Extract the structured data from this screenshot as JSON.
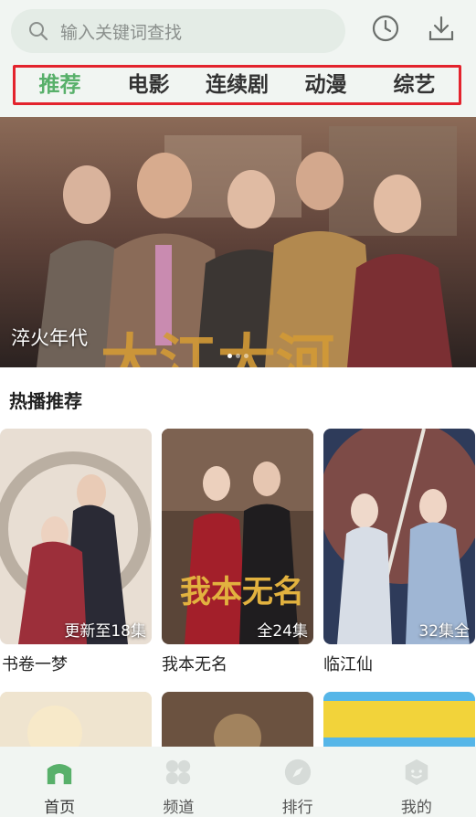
{
  "search": {
    "placeholder": "输入关键词查找"
  },
  "icons": {
    "search": "search-icon",
    "history": "clock-icon",
    "download": "download-icon"
  },
  "tabs": [
    {
      "label": "推荐",
      "active": true
    },
    {
      "label": "电影"
    },
    {
      "label": "连续剧"
    },
    {
      "label": "动漫"
    },
    {
      "label": "综艺"
    }
  ],
  "banner": {
    "title": "淬火年代"
  },
  "hot": {
    "title": "热播推荐",
    "items": [
      {
        "title": "书卷一梦",
        "badge": "更新至18集"
      },
      {
        "title": "我本无名",
        "badge": "全24集"
      },
      {
        "title": "临江仙",
        "badge": "32集全"
      }
    ]
  },
  "nav": [
    {
      "label": "首页",
      "icon": "home-icon",
      "active": true
    },
    {
      "label": "频道",
      "icon": "grid-icon"
    },
    {
      "label": "排行",
      "icon": "compass-icon"
    },
    {
      "label": "我的",
      "icon": "profile-icon"
    }
  ],
  "colors": {
    "accent": "#58b06a",
    "highlight_border": "#e3232d",
    "header_bg": "#f1f5f2"
  }
}
